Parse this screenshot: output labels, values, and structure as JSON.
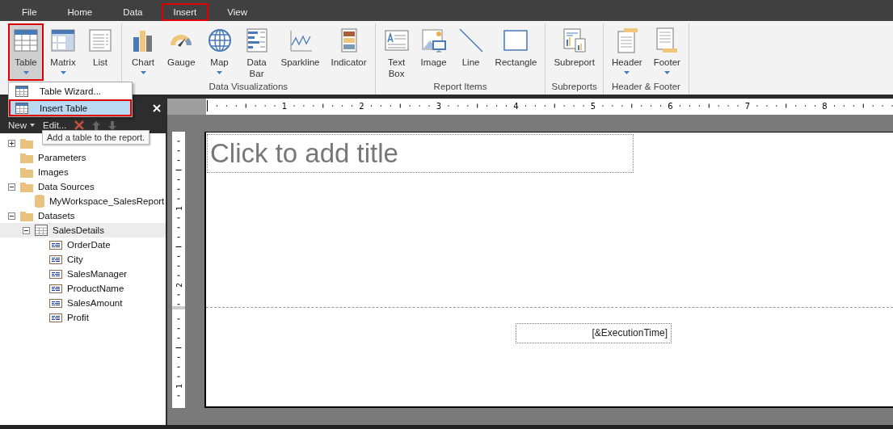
{
  "tabs": [
    {
      "label": "File",
      "selected": false
    },
    {
      "label": "Home",
      "selected": false
    },
    {
      "label": "Data",
      "selected": false
    },
    {
      "label": "Insert",
      "selected": true
    },
    {
      "label": "View",
      "selected": false
    }
  ],
  "ribbon": {
    "groups": [
      {
        "items": [
          {
            "kind": "table",
            "label": "Table",
            "dropdown": true,
            "selected": true
          },
          {
            "kind": "matrix",
            "label": "Matrix",
            "dropdown": true,
            "selected": false
          },
          {
            "kind": "list",
            "label": "List",
            "dropdown": false,
            "selected": false
          }
        ]
      },
      {
        "label": "Data Visualizations",
        "items": [
          {
            "kind": "chart",
            "label": "Chart",
            "dropdown": true,
            "selected": false
          },
          {
            "kind": "gauge",
            "label": "Gauge",
            "dropdown": false,
            "selected": false
          },
          {
            "kind": "map",
            "label": "Map",
            "dropdown": true,
            "selected": false
          },
          {
            "kind": "databar",
            "label": "Data Bar",
            "dropdown": false,
            "selected": false
          },
          {
            "kind": "sparkline",
            "label": "Sparkline",
            "dropdown": false,
            "selected": false
          },
          {
            "kind": "indicator",
            "label": "Indicator",
            "dropdown": false,
            "selected": false
          }
        ]
      },
      {
        "label": "Report Items",
        "items": [
          {
            "kind": "textbox",
            "label": "Text Box",
            "dropdown": false,
            "selected": false
          },
          {
            "kind": "image",
            "label": "Image",
            "dropdown": false,
            "selected": false
          },
          {
            "kind": "line",
            "label": "Line",
            "dropdown": false,
            "selected": false
          },
          {
            "kind": "rectangle",
            "label": "Rectangle",
            "dropdown": false,
            "selected": false
          }
        ]
      },
      {
        "label": "Subreports",
        "items": [
          {
            "kind": "subreport",
            "label": "Subreport",
            "dropdown": false,
            "selected": false
          }
        ]
      },
      {
        "label": "Header & Footer",
        "items": [
          {
            "kind": "header",
            "label": "Header",
            "dropdown": true,
            "selected": false
          },
          {
            "kind": "footer",
            "label": "Footer",
            "dropdown": true,
            "selected": false
          }
        ]
      }
    ]
  },
  "dropdown_menu": [
    {
      "label": "Table Wizard...",
      "selected": false
    },
    {
      "label": "Insert Table",
      "selected": true
    }
  ],
  "tooltip": "Add a table to the report.",
  "report_data_panel": {
    "toolbar": {
      "new": "New",
      "edit": "Edit..."
    },
    "tree": [
      {
        "kind": "folder",
        "expanded": false,
        "selected": false
      },
      {
        "kind": "folder",
        "label": "Parameters",
        "selected": false
      },
      {
        "kind": "folder",
        "label": "Images",
        "selected": false
      },
      {
        "kind": "folder",
        "label": "Data Sources",
        "expanded": true,
        "selected": false,
        "children": [
          {
            "kind": "datasource",
            "label": "MyWorkspace_SalesReport",
            "selected": false
          }
        ]
      },
      {
        "kind": "folder",
        "label": "Datasets",
        "expanded": true,
        "selected": false,
        "children": [
          {
            "kind": "dataset",
            "label": "SalesDetails",
            "expanded": true,
            "selected": true,
            "children": [
              {
                "kind": "field",
                "label": "OrderDate",
                "selected": false
              },
              {
                "kind": "field",
                "label": "City",
                "selected": false
              },
              {
                "kind": "field",
                "label": "SalesManager",
                "selected": false
              },
              {
                "kind": "field",
                "label": "ProductName",
                "selected": false
              },
              {
                "kind": "field",
                "label": "SalesAmount",
                "selected": false
              },
              {
                "kind": "field",
                "label": "Profit",
                "selected": false
              }
            ]
          }
        ]
      }
    ]
  },
  "ruler": {
    "horizontal": [
      "1",
      "2",
      "3",
      "4",
      "5",
      "6",
      "7",
      "8"
    ],
    "vertical_body": [
      "1",
      "2"
    ],
    "vertical_footer": [
      "1"
    ]
  },
  "report": {
    "title_placeholder": "Click to add title",
    "footer_expression": "[&ExecutionTime]"
  }
}
